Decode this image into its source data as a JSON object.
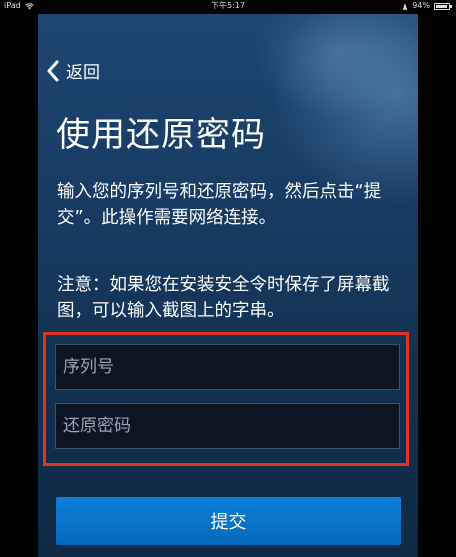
{
  "status_bar": {
    "device": "iPad",
    "time": "下午5:17",
    "battery": "94%",
    "battery_level": 0.94
  },
  "header": {
    "back_label": "返回"
  },
  "main": {
    "title": "使用还原密码",
    "instructions": "输入您的序列号和还原密码，然后点击“提交”。此操作需要网络连接。",
    "note": "注意：如果您在安装安全令时保存了屏幕截图，可以输入截图上的字串。"
  },
  "form": {
    "serial": {
      "value": "",
      "placeholder": "序列号"
    },
    "restore_code": {
      "value": "",
      "placeholder": "还原密码"
    },
    "submit_label": "提交"
  },
  "colors": {
    "highlight_border": "#e2341d",
    "button": "#0a76cf",
    "panel": "#183b63"
  }
}
